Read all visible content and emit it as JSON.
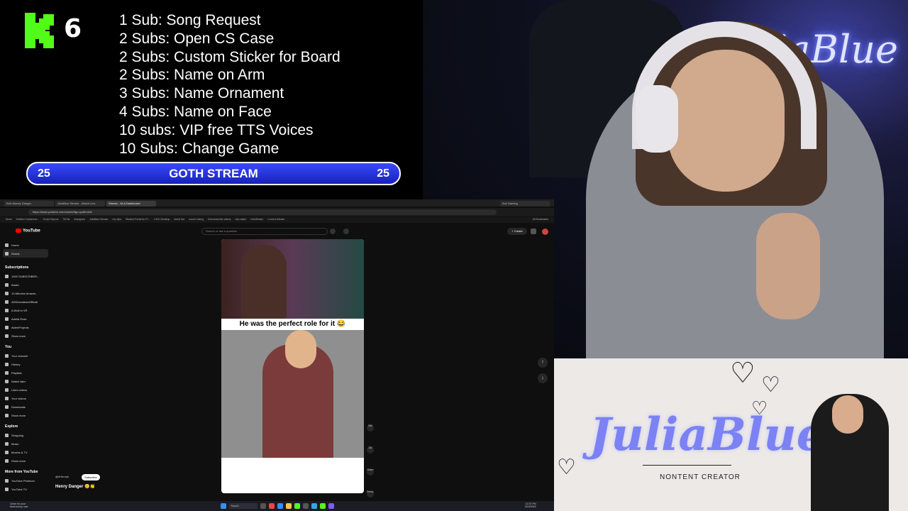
{
  "overlay": {
    "logo_count": "6",
    "goals": [
      "1 Sub: Song Request",
      "2 Subs: Open CS Case",
      "2 Subs: Custom Sticker for Board",
      "2 Subs: Name on Arm",
      "3 Subs: Name Ornament",
      "4 Subs: Name on Face",
      "10 subs: VIP free TTS Voices",
      "10 Subs: Change Game"
    ],
    "goal_bar": {
      "left": "25",
      "title": "GOTH STREAM",
      "right": "25"
    }
  },
  "webcam": {
    "neon_sign": "JuliaBlue"
  },
  "browser": {
    "tabs": [
      "Kick Money Danger",
      "JuliaBlue Stream - Watch Live",
      "Stream - KLA Dashboard",
      "Ack Gaming"
    ],
    "url": "https://www.youtube.com/shorts/9gx-qrx8rh4rM",
    "bookmarks": [
      "Items",
      "KickBot Customiza...",
      "Script Sayous",
      "TikTok",
      "Instagram",
      "JuliaBlue Stream",
      "my clips",
      "Student Portal for Ft...",
      "KICK Desktop",
      "shred live",
      "sound mixing",
      "Download the videos",
      "clip maker",
      "KickStream",
      "Current Articles",
      "All Bookmarks"
    ],
    "youtube": {
      "logo": "YouTube",
      "search_placeholder": "Search or ask a question",
      "create_label": "+ Create",
      "sidebar_top": [
        "Home",
        "Shorts"
      ],
      "subscriptions_title": "Subscriptions",
      "subscriptions": [
        "1000 SUBSCRIBER...",
        "ihasld",
        "10-Minutes Amazin...",
        "4000creativesOfficial",
        "A Wolf in VR",
        "Adelia Rose",
        "AidenProjects",
        "Show more"
      ],
      "you_title": "You",
      "you_items": [
        "Your channel",
        "History",
        "Playlists",
        "Watch later",
        "Liked videos",
        "Your videos",
        "Downloads",
        "Show more"
      ],
      "explore_title": "Explore",
      "explore_items": [
        "Shopping",
        "Music",
        "Movies & TV",
        "Show more"
      ],
      "more_title": "More from YouTube",
      "more_items": [
        "YouTube Premium",
        "YouTube TV"
      ],
      "short_caption": "He was the perfect role for it 😂",
      "channel": "@eHenryh",
      "subscribe_label": "Subscribe",
      "video_title": "Henry Danger 🥲👏",
      "actions": [
        "36K",
        "182",
        "Share",
        "Remix"
      ]
    },
    "taskbar": {
      "weather": "Clean for your\nMost sunny now",
      "search": "Search",
      "clock": "12:37 PM\n9/23/2024"
    }
  },
  "branding": {
    "name": "JuliaBlue",
    "tagline": "NONTENT CREATOR"
  },
  "colors": {
    "goal_bar": "#2230e0",
    "brand_name": "#7c82f3",
    "kick_green": "#53fc18",
    "yt_red": "#ff0000"
  }
}
